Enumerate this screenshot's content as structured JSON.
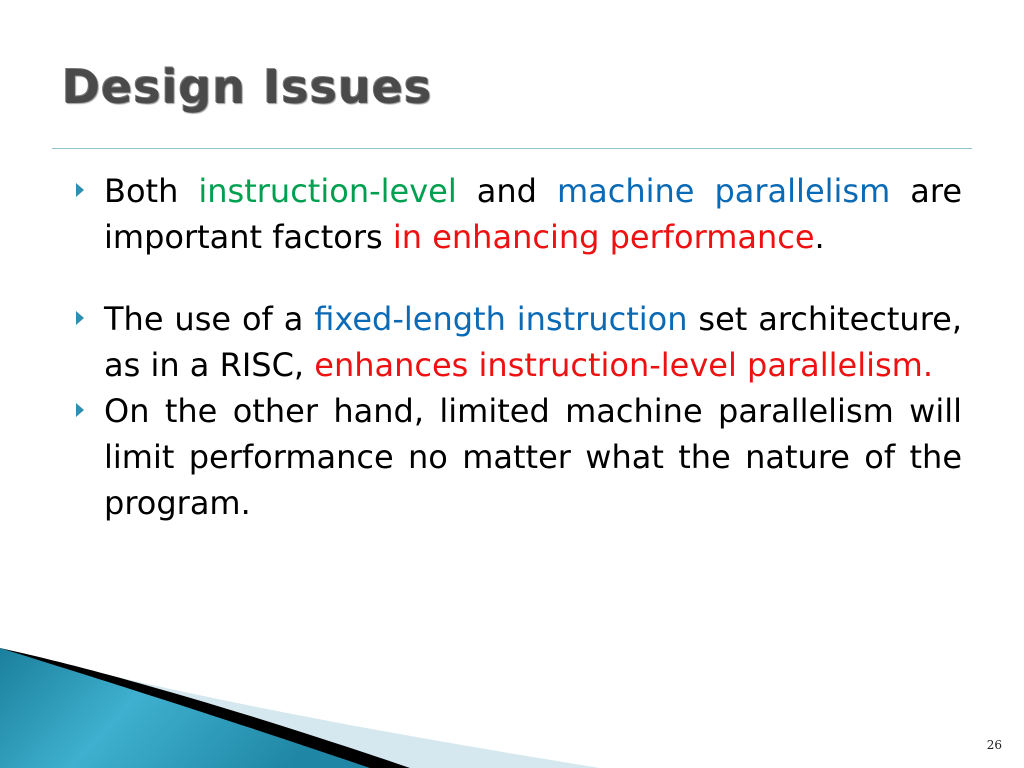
{
  "slide": {
    "title": "Design Issues",
    "page_number": "26",
    "colors": {
      "accent": "#2e8fb0",
      "green": "#00a050",
      "blue": "#0a6ab5",
      "red": "#ee1111",
      "title": "#4a4a4a"
    }
  },
  "bullets": [
    {
      "segments": [
        {
          "text": "Both ",
          "color": "black"
        },
        {
          "text": "instruction-level",
          "color": "green"
        },
        {
          "text": " and ",
          "color": "black"
        },
        {
          "text": "machine parallelism",
          "color": "blue"
        },
        {
          "text": " are important factors ",
          "color": "black"
        },
        {
          "text": "in enhancing performance",
          "color": "red"
        },
        {
          "text": ".",
          "color": "black"
        }
      ]
    },
    {
      "segments": [
        {
          "text": "The use of a ",
          "color": "black"
        },
        {
          "text": "fixed-length instruction",
          "color": "blue"
        },
        {
          "text": " set architecture, as in a RISC, ",
          "color": "black"
        },
        {
          "text": "enhances instruction-level parallelism.",
          "color": "red"
        }
      ]
    },
    {
      "segments": [
        {
          "text": "On the other hand, limited machine parallelism will limit performance no matter what the nature of the program.",
          "color": "black"
        }
      ]
    }
  ]
}
